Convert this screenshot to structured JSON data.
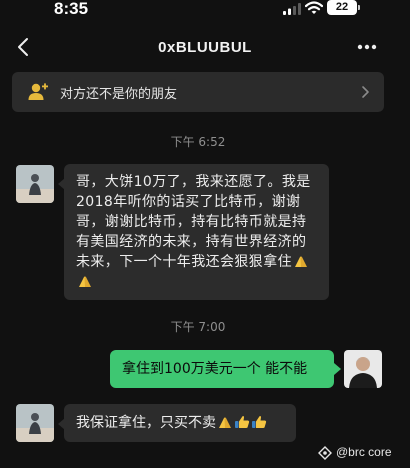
{
  "status_bar": {
    "time": "8:35",
    "battery": "22"
  },
  "header": {
    "title": "0xBLUUBUL"
  },
  "banner": {
    "text": "对方还不是你的朋友"
  },
  "messages": [
    {
      "timestamp": "下午 6:52",
      "side": "left",
      "text": "哥，大饼10万了，我来还愿了。我是2018年听你的话买了比特币，谢谢哥，谢谢比特币，持有比特币就是持有美国经济的未来，持有世界经济的未来，下一个十年我还会狠狠拿住",
      "emoji": [
        "folded-hands-emoji",
        "folded-hands-emoji"
      ]
    },
    {
      "timestamp": "下午 7:00",
      "side": "right",
      "text": "拿住到100万美元一个 能不能",
      "emoji": []
    },
    {
      "side": "left",
      "text": "我保证拿住，只买不卖",
      "emoji": [
        "folded-hands-emoji",
        "thumbs-up-emoji",
        "thumbs-up-emoji"
      ]
    }
  ],
  "watermark": {
    "text": "@brc core"
  },
  "colors": {
    "background": "#111111",
    "incoming_bubble": "#2c2c2c",
    "outgoing_bubble": "#3ec772",
    "banner": "#2b2b2b",
    "timestamp_text": "#8f8f8f",
    "emoji_yellow": "#f5c542"
  },
  "icons": {
    "back": "chevron-left-icon",
    "more": "more-dots-icon",
    "banner": "person-add-icon",
    "banner_chevron": "chevron-right-icon",
    "watermark": "logo-icon"
  }
}
